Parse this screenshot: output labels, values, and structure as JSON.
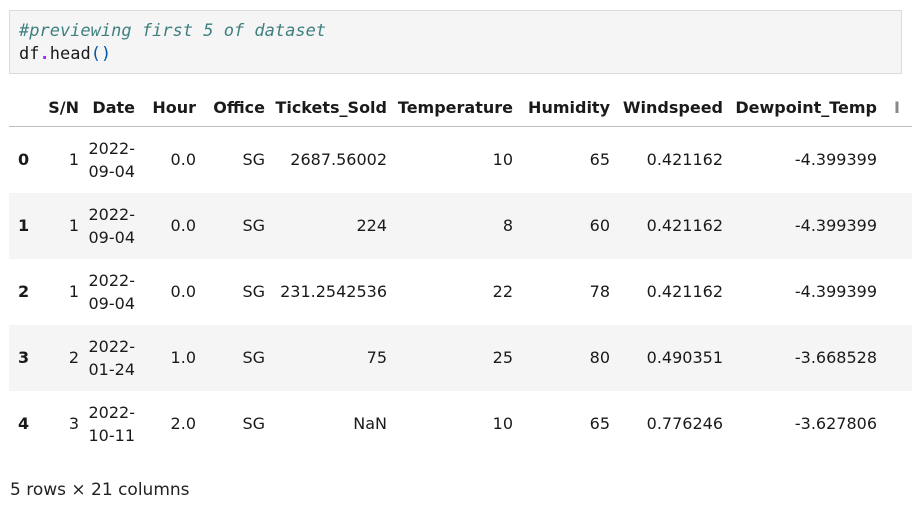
{
  "code_cell": {
    "comment": "#previewing first 5 of dataset",
    "code_obj": "df",
    "code_dot": ".",
    "code_method": "head",
    "code_parens": "()"
  },
  "table": {
    "columns": [
      "",
      "S/N",
      "Date",
      "Hour",
      "Office",
      "Tickets_Sold",
      "Temperature",
      "Humidity",
      "Windspeed",
      "Dewpoint_Temp",
      "I"
    ],
    "rows": [
      {
        "index": "0",
        "sn": "1",
        "date_a": "2022-",
        "date_b": "09-04",
        "hour": "0.0",
        "office": "SG",
        "tickets": "2687.56002",
        "temp": "10",
        "humidity": "65",
        "wind": "0.421162",
        "dew": "-4.399399"
      },
      {
        "index": "1",
        "sn": "1",
        "date_a": "2022-",
        "date_b": "09-04",
        "hour": "0.0",
        "office": "SG",
        "tickets": "224",
        "temp": "8",
        "humidity": "60",
        "wind": "0.421162",
        "dew": "-4.399399"
      },
      {
        "index": "2",
        "sn": "1",
        "date_a": "2022-",
        "date_b": "09-04",
        "hour": "0.0",
        "office": "SG",
        "tickets": "231.2542536",
        "temp": "22",
        "humidity": "78",
        "wind": "0.421162",
        "dew": "-4.399399"
      },
      {
        "index": "3",
        "sn": "2",
        "date_a": "2022-",
        "date_b": "01-24",
        "hour": "1.0",
        "office": "SG",
        "tickets": "75",
        "temp": "25",
        "humidity": "80",
        "wind": "0.490351",
        "dew": "-3.668528"
      },
      {
        "index": "4",
        "sn": "3",
        "date_a": "2022-",
        "date_b": "10-11",
        "hour": "2.0",
        "office": "SG",
        "tickets": "NaN",
        "temp": "10",
        "humidity": "65",
        "wind": "0.776246",
        "dew": "-3.627806"
      }
    ]
  },
  "footer": {
    "shape_text": "5 rows × 21 columns"
  }
}
